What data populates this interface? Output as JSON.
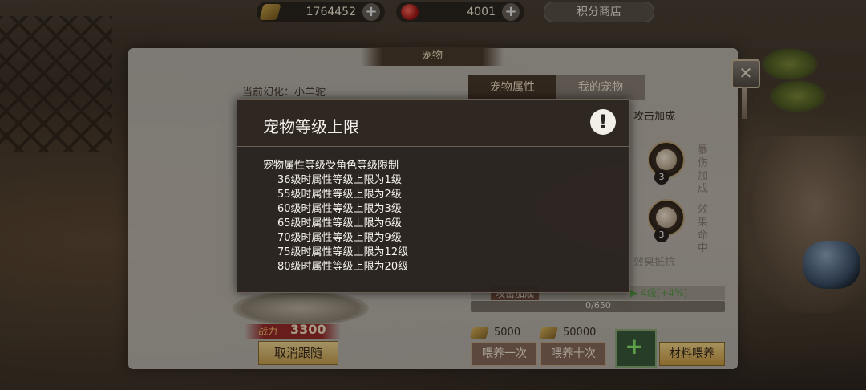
{
  "topbar": {
    "gold_amount": "1764452",
    "ruby_amount": "4001",
    "plus_symbol": "+",
    "shop_label": "积分商店",
    "icons": [
      "gold-ingot-icon",
      "ruby-icon",
      "plus-icon"
    ]
  },
  "panel": {
    "title": "宠物",
    "close_symbol": "✕",
    "current_form": "当前幻化：小羊驼",
    "tabs": [
      {
        "label": "宠物属性",
        "active": true
      },
      {
        "label": "我的宠物",
        "active": false
      }
    ]
  },
  "attributes": {
    "attack_bonus_label": "攻击加成",
    "skills": [
      {
        "name_line1": "暴伤",
        "name_line2": "加成",
        "level": "3",
        "icon": "crit-damage-icon"
      },
      {
        "name_line1": "效果",
        "name_line2": "命中",
        "level": "3",
        "icon": "effect-hit-icon"
      }
    ],
    "effect_resist_label": "效果抵抗",
    "upgrade": {
      "tag": "攻击加成",
      "current": "3级(+3%)",
      "arrow": "▶",
      "next": "4级(+4%)",
      "progress_text": "0/650",
      "progress_fraction": 0
    }
  },
  "feeding": {
    "feed_once_cost": "5000",
    "feed_ten_cost": "50000",
    "feed_once_label": "喂养一次",
    "feed_ten_label": "喂养十次",
    "material_plus": "+",
    "material_feed_label": "材料喂养"
  },
  "pet": {
    "power_label": "战力",
    "power_value": "3300",
    "unfollow_label": "取消跟随"
  },
  "dialog": {
    "title": "宠物等级上限",
    "warn_symbol": "!",
    "intro": "宠物属性等级受角色等级限制",
    "rules": [
      "36级时属性等级上限为1级",
      "55级时属性等级上限为2级",
      "60级时属性等级上限为3级",
      "65级时属性等级上限为6级",
      "70级时属性等级上限为9级",
      "75级时属性等级上限为12级",
      "80级时属性等级上限为20级"
    ]
  }
}
